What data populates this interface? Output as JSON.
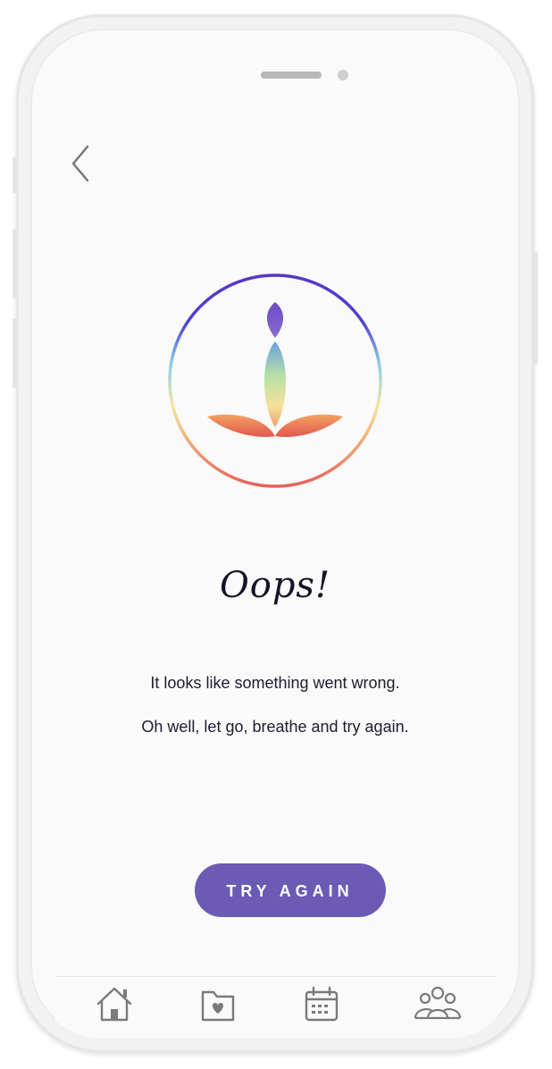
{
  "screen": {
    "title": "Oops!",
    "message_line_1": "It looks like something went wrong.",
    "message_line_2": "Oh well, let go, breathe and try again.",
    "button_label": "TRY AGAIN"
  },
  "icons": {
    "back": "chevron-left-icon",
    "logo": "meditation-lotus-logo",
    "tabs": [
      "home-icon",
      "favorites-folder-icon",
      "calendar-icon",
      "community-icon"
    ]
  },
  "colors": {
    "accent": "#6b5bb5",
    "text": "#1c1c2e",
    "background": "#fafafa",
    "icon_gray": "#7a7a7a"
  }
}
